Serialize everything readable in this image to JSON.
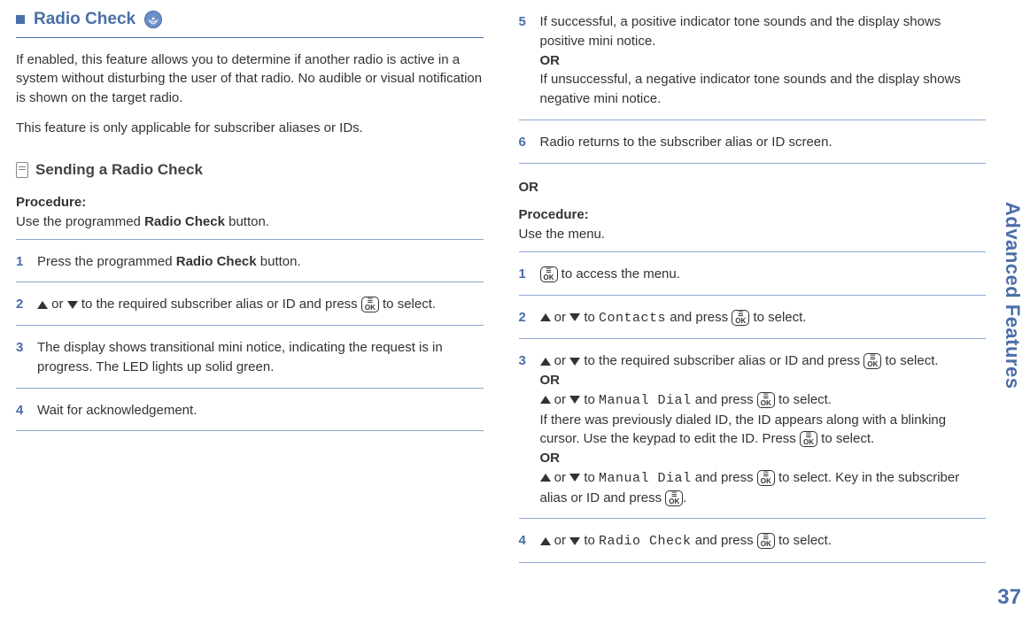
{
  "sidebar": {
    "label": "Advanced Features"
  },
  "page_number": "37",
  "section": {
    "title": "Radio Check",
    "intro1": "If enabled, this feature allows you to determine if another radio is active in a system without disturbing the user of that radio. No audible or visual notification is shown on the target radio.",
    "intro2": "This feature is only applicable for subscriber aliases or IDs."
  },
  "subsection": {
    "title": "Sending a Radio Check",
    "procedure_label": "Procedure:",
    "procedure_intro": "Use the programmed ",
    "procedure_intro_bold": "Radio Check",
    "procedure_intro_suffix": " button."
  },
  "steps_left": {
    "s1_num": "1",
    "s1_a": "Press the programmed ",
    "s1_b": "Radio Check",
    "s1_c": " button.",
    "s2_num": "2",
    "s2_a": " or ",
    "s2_b": " to the required subscriber alias or ID and press ",
    "s2_c": " to select.",
    "s3_num": "3",
    "s3": "The display shows transitional mini notice, indicating the request is in progress. The LED lights up solid green.",
    "s4_num": "4",
    "s4": "Wait for acknowledgement."
  },
  "steps_right": {
    "s5_num": "5",
    "s5_a": "If successful, a positive indicator tone sounds and the display shows positive mini notice.",
    "s5_or": "OR",
    "s5_b": "If unsuccessful, a negative indicator tone sounds and the display shows negative mini notice.",
    "s6_num": "6",
    "s6": "Radio returns to the subscriber alias or ID screen.",
    "or_big": "OR",
    "proc2_label": "Procedure:",
    "proc2_intro": "Use the menu.",
    "m1_num": "1",
    "m1": " to access the menu.",
    "m2_num": "2",
    "m2_a": " or ",
    "m2_b": " to ",
    "m2_c": "Contacts",
    "m2_d": " and press ",
    "m2_e": " to select.",
    "m3_num": "3",
    "m3_a": " or ",
    "m3_b": " to the required subscriber alias or ID and press ",
    "m3_c": " to select.",
    "m3_or1": "OR",
    "m3_d": " or ",
    "m3_e": " to ",
    "m3_f": "Manual Dial",
    "m3_g": " and press ",
    "m3_h": " to select.",
    "m3_i": "If there was previously dialed ID, the ID appears along with a blinking cursor. Use the keypad to edit the ID. Press ",
    "m3_j": " to select.",
    "m3_or2": "OR",
    "m3_k": " or ",
    "m3_l": " to ",
    "m3_m": "Manual Dial",
    "m3_n": " and press ",
    "m3_o": " to select. Key in the subscriber alias or ID and press ",
    "m3_p": ".",
    "m4_num": "4",
    "m4_a": " or ",
    "m4_b": " to ",
    "m4_c": "Radio Check",
    "m4_d": " and press ",
    "m4_e": " to select."
  },
  "ok_label": "OK"
}
